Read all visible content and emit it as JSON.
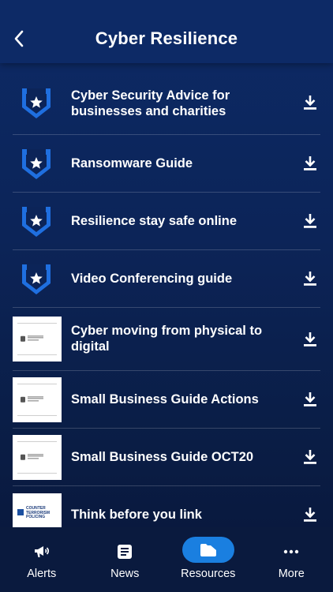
{
  "header": {
    "title": "Cyber Resilience"
  },
  "resources": [
    {
      "title": "Cyber Security Advice for businesses and charities",
      "thumb": "shield-icon"
    },
    {
      "title": "Ransomware Guide",
      "thumb": "shield-icon"
    },
    {
      "title": "Resilience stay safe online",
      "thumb": "shield-icon"
    },
    {
      "title": "Video Conferencing guide",
      "thumb": "shield-icon"
    },
    {
      "title": "Cyber moving from physical to digital",
      "thumb": "document-thumbnail"
    },
    {
      "title": "Small Business Guide Actions",
      "thumb": "document-thumbnail"
    },
    {
      "title": "Small Business Guide OCT20",
      "thumb": "document-thumbnail"
    },
    {
      "title": "Think before you link",
      "thumb": "ctp-logo-thumbnail",
      "thumb_text": [
        "COUNTER",
        "TERRORISM",
        "POLICING"
      ]
    }
  ],
  "tabs": [
    {
      "label": "Alerts",
      "icon": "megaphone-icon"
    },
    {
      "label": "News",
      "icon": "news-icon"
    },
    {
      "label": "Resources",
      "icon": "folder-icon",
      "active": true
    },
    {
      "label": "More",
      "icon": "more-dots-icon"
    }
  ],
  "colors": {
    "accent": "#1a7fe0",
    "background": "#0c2458",
    "shield": "#1f6fe0"
  }
}
